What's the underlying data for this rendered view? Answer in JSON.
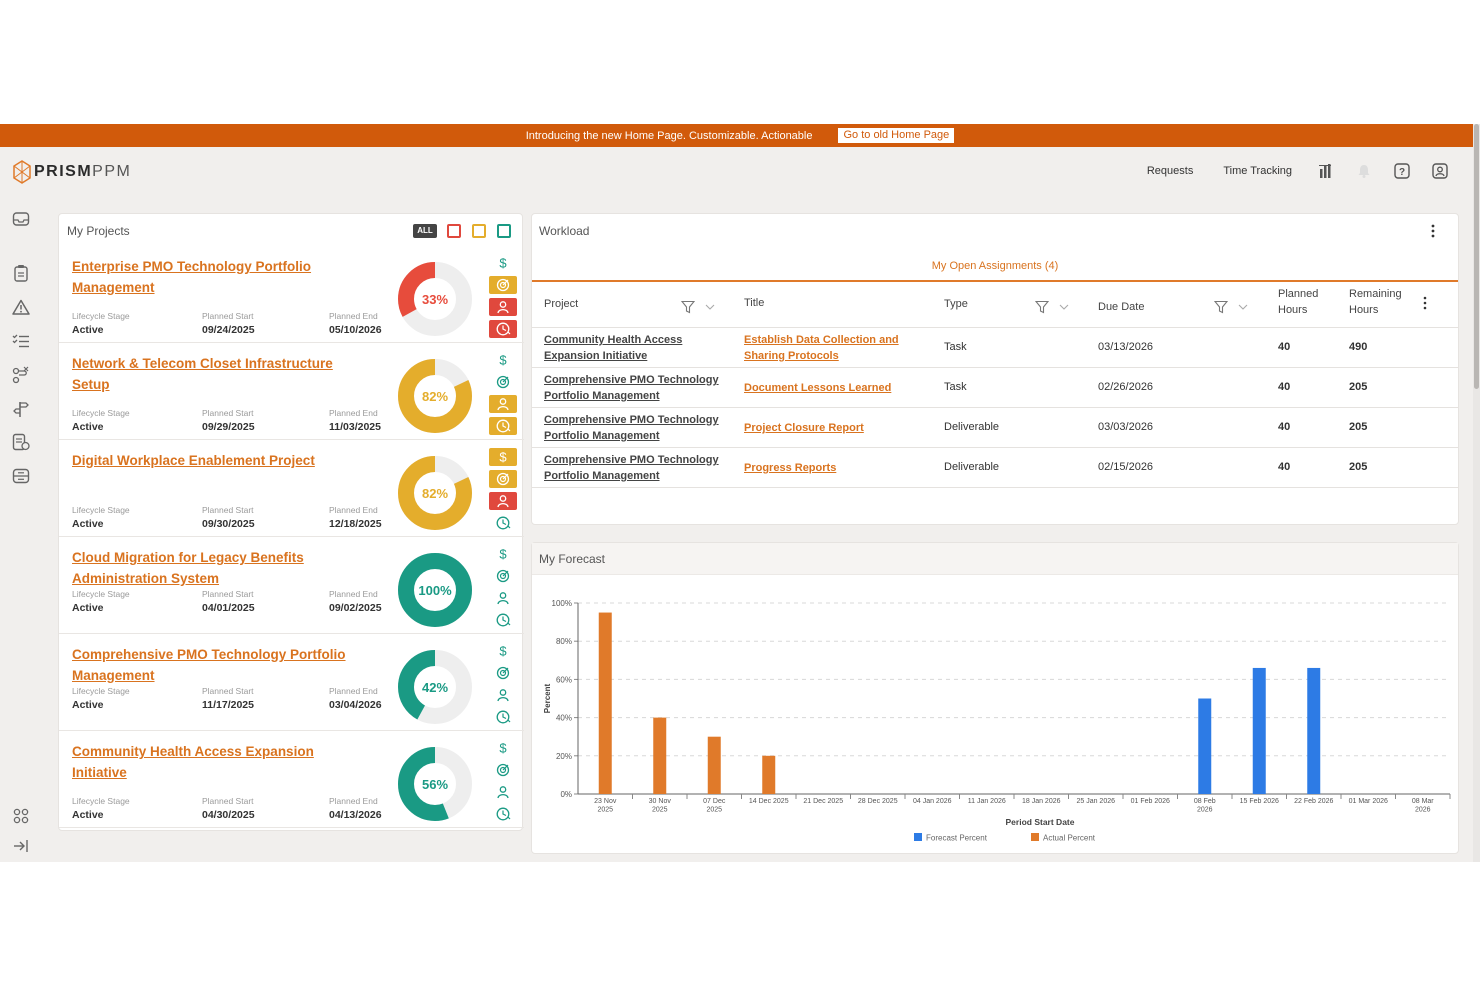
{
  "banner": {
    "text": "Introducing the new Home Page. Customizable. Actionable",
    "link": "Go to old Home Page"
  },
  "brand": {
    "bold": "PRISM",
    "light": "PPM"
  },
  "nav": {
    "requests": "Requests",
    "time_tracking": "Time Tracking"
  },
  "projects_panel": {
    "title": "My Projects",
    "filter_all": "ALL",
    "labels": {
      "stage": "Lifecycle Stage",
      "start": "Planned Start",
      "end": "Planned End"
    },
    "items": [
      {
        "name": "Enterprise PMO Technology Portfolio Management",
        "stage": "Active",
        "start": "09/24/2025",
        "end": "05/10/2026",
        "percent": 33,
        "percent_label": "33%",
        "color": "#e74c3c",
        "status": [
          "plain",
          "yellow",
          "red",
          "red"
        ]
      },
      {
        "name": "Network & Telecom Closet Infrastructure Setup",
        "stage": "Active",
        "start": "09/29/2025",
        "end": "11/03/2025",
        "percent": 82,
        "percent_label": "82%",
        "color": "#e4ad2c",
        "status": [
          "plain",
          "plain",
          "yellow",
          "yellow"
        ]
      },
      {
        "name": "Digital Workplace Enablement Project",
        "stage": "Active",
        "start": "09/30/2025",
        "end": "12/18/2025",
        "percent": 82,
        "percent_label": "82%",
        "color": "#e4ad2c",
        "status": [
          "yellow",
          "yellow",
          "red",
          "plain"
        ]
      },
      {
        "name": "Cloud Migration for Legacy Benefits Administration System",
        "stage": "Active",
        "start": "04/01/2025",
        "end": "09/02/2025",
        "percent": 100,
        "percent_label": "100%",
        "color": "#1a9a84",
        "status": [
          "plain",
          "plain",
          "plain",
          "plain"
        ]
      },
      {
        "name": "Comprehensive PMO Technology Portfolio Management",
        "stage": "Active",
        "start": "11/17/2025",
        "end": "03/04/2026",
        "percent": 42,
        "percent_label": "42%",
        "color": "#1a9a84",
        "status": [
          "plain",
          "plain",
          "plain",
          "plain"
        ]
      },
      {
        "name": "Community Health Access Expansion Initiative",
        "stage": "Active",
        "start": "04/30/2025",
        "end": "04/13/2026",
        "percent": 56,
        "percent_label": "56%",
        "color": "#1a9a84",
        "status": [
          "plain",
          "plain",
          "plain",
          "plain"
        ]
      }
    ]
  },
  "workload": {
    "title": "Workload",
    "tab": "My Open Assignments  (4)",
    "columns": {
      "project": "Project",
      "title": "Title",
      "type": "Type",
      "due": "Due Date",
      "planned_1": "Planned",
      "planned_2": "Hours",
      "remaining_1": "Remaining",
      "remaining_2": "Hours"
    },
    "rows": [
      {
        "project_1": "Community Health Access",
        "project_2": "Expansion Initiative",
        "title_1": "Establish Data Collection and",
        "title_2": "Sharing Protocols",
        "type": "Task",
        "due": "03/13/2026",
        "planned": "40",
        "remaining": "490"
      },
      {
        "project_1": "Comprehensive PMO Technology",
        "project_2": "Portfolio Management",
        "title_1": "Document Lessons Learned",
        "title_2": "",
        "type": "Task",
        "due": "02/26/2026",
        "planned": "40",
        "remaining": "205"
      },
      {
        "project_1": "Comprehensive PMO Technology",
        "project_2": "Portfolio Management",
        "title_1": "Project Closure Report",
        "title_2": "",
        "type": "Deliverable",
        "due": "03/03/2026",
        "planned": "40",
        "remaining": "205"
      },
      {
        "project_1": "Comprehensive PMO Technology",
        "project_2": "Portfolio Management",
        "title_1": "Progress Reports",
        "title_2": "",
        "type": "Deliverable",
        "due": "02/15/2026",
        "planned": "40",
        "remaining": "205"
      }
    ]
  },
  "forecast": {
    "title": "My Forecast",
    "colors": {
      "forecast": "#2d7be5",
      "actual": "#e07a2a"
    }
  },
  "chart_data": {
    "type": "bar",
    "categories": [
      "23 Nov 2025",
      "30 Nov 2025",
      "07 Dec 2025",
      "14 Dec 2025",
      "21 Dec 2025",
      "28 Dec 2025",
      "04 Jan 2026",
      "11 Jan 2026",
      "18 Jan 2026",
      "25 Jan 2026",
      "01 Feb 2026",
      "08 Feb 2026",
      "15 Feb 2026",
      "22 Feb 2026",
      "01 Mar 2026",
      "08 Mar 2026"
    ],
    "series": [
      {
        "name": "Forecast Percent",
        "values": [
          0,
          0,
          0,
          0,
          0,
          0,
          0,
          0,
          0,
          0,
          0,
          50,
          66,
          66,
          0,
          0
        ]
      },
      {
        "name": "Actual Percent",
        "values": [
          95,
          40,
          30,
          20,
          0,
          0,
          0,
          0,
          0,
          0,
          0,
          0,
          0,
          0,
          0,
          0
        ]
      }
    ],
    "title": "",
    "xlabel": "Period Start Date",
    "ylabel": "Percent",
    "ylim": [
      0,
      100
    ],
    "yticks": [
      "0%",
      "20%",
      "40%",
      "60%",
      "80%",
      "100%"
    ],
    "grid": true,
    "legend": "bottom"
  }
}
